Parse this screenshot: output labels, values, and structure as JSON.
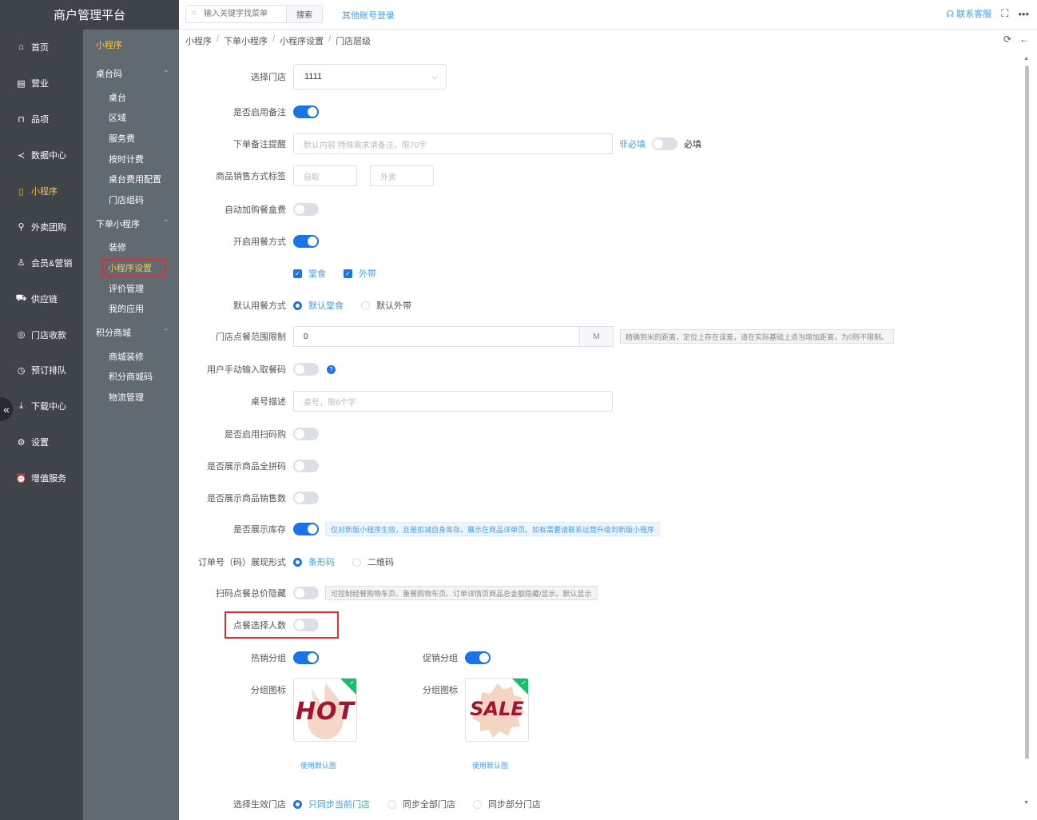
{
  "brand": "商户管理平台",
  "topbar": {
    "search_placeholder": "输入关键字找菜单",
    "search_button": "搜索",
    "other_login": "其他账号登录",
    "contact": "联系客服"
  },
  "nav1": [
    {
      "label": "首页",
      "icon": "home-icon"
    },
    {
      "label": "营业",
      "icon": "business-icon"
    },
    {
      "label": "品项",
      "icon": "bag-icon"
    },
    {
      "label": "数据中心",
      "icon": "share-icon"
    },
    {
      "label": "小程序",
      "icon": "mini-program-icon"
    },
    {
      "label": "外卖团购",
      "icon": "bike-icon"
    },
    {
      "label": "会员&营销",
      "icon": "user-icon"
    },
    {
      "label": "供应链",
      "icon": "truck-icon"
    },
    {
      "label": "门店收款",
      "icon": "coins-icon"
    },
    {
      "label": "预订排队",
      "icon": "clock-icon"
    },
    {
      "label": "下载中心",
      "icon": "download-icon"
    },
    {
      "label": "设置",
      "icon": "gear-icon"
    },
    {
      "label": "增值服务",
      "icon": "alarm-icon"
    }
  ],
  "nav2": {
    "title": "小程序",
    "groups": [
      {
        "label": "桌台码",
        "items": [
          "桌台",
          "区域",
          "服务费",
          "按时计费",
          "桌台费用配置",
          "门店组码"
        ]
      },
      {
        "label": "下单小程序",
        "items": [
          "装修",
          "小程序设置",
          "评价管理",
          "我的应用"
        ]
      },
      {
        "label": "积分商城",
        "items": [
          "商城装修",
          "积分商城码",
          "物流管理"
        ]
      }
    ]
  },
  "breadcrumb": [
    "小程序",
    "下单小程序",
    "小程序设置",
    "门店层级"
  ],
  "form": {
    "store_label": "选择门店",
    "store_value": "1111",
    "remark_enable_label": "是否启用备注",
    "remark_tip_label": "下单备注提醒",
    "remark_tip_placeholder": "默认内容 特殊需求请备注，限70字",
    "optional": "非必填",
    "required": "必填",
    "sales_tag_label": "商品销售方式标签",
    "tag_pickup": "自取",
    "tag_delivery": "外卖",
    "auto_box_label": "自动加购餐盒费",
    "dining_mode_label": "开启用餐方式",
    "dine_in": "堂食",
    "takeout": "外带",
    "default_mode_label": "默认用餐方式",
    "default_dine_in": "默认堂食",
    "default_takeout": "默认外带",
    "range_label": "门店点餐范围限制",
    "range_value": "0",
    "range_unit": "M",
    "range_note": "精确到米的距离，定位上存在误差，请在实际基础上适当增加距离，为0则不限制。",
    "manual_code_label": "用户手动输入取餐码",
    "table_desc_label": "桌号描述",
    "table_desc_placeholder": "桌号，限6个字",
    "scan_buy_label": "是否启用扫码购",
    "show_pinyin_label": "是否展示商品全拼码",
    "show_sales_label": "是否展示商品销售数",
    "show_stock_label": "是否展示库存",
    "stock_note": "仅对新版小程序生效，且是扣减自身库存。展示在商品详单页。如有需要请联系运营升级到新版小程序",
    "order_code_label": "订单号（码）展现形式",
    "barcode": "条形码",
    "qrcode": "二维码",
    "hide_total_label": "扫码点餐总价隐藏",
    "hide_total_note": "可控制经餐购物车页、重餐购物车页、订单详情页商品总金额隐藏/显示。默认显示",
    "choose_people_label": "点餐选择人数",
    "hot_group_label": "热销分组",
    "promo_group_label": "促销分组",
    "group_icon_label": "分组图标",
    "hot_img_text": "HOT",
    "sale_img_text": "SALE",
    "use_default": "使用默认图",
    "effective_store_label": "选择生效门店",
    "sync_current": "只同步当前门店",
    "sync_all": "同步全部门店",
    "sync_part": "同步部分门店"
  },
  "colors": {
    "sidebar_dark": "#3e4449",
    "sidebar_light": "#616a71",
    "accent": "#1a73e8",
    "highlight": "#e52b2b",
    "active_menu": "#f6c245"
  }
}
